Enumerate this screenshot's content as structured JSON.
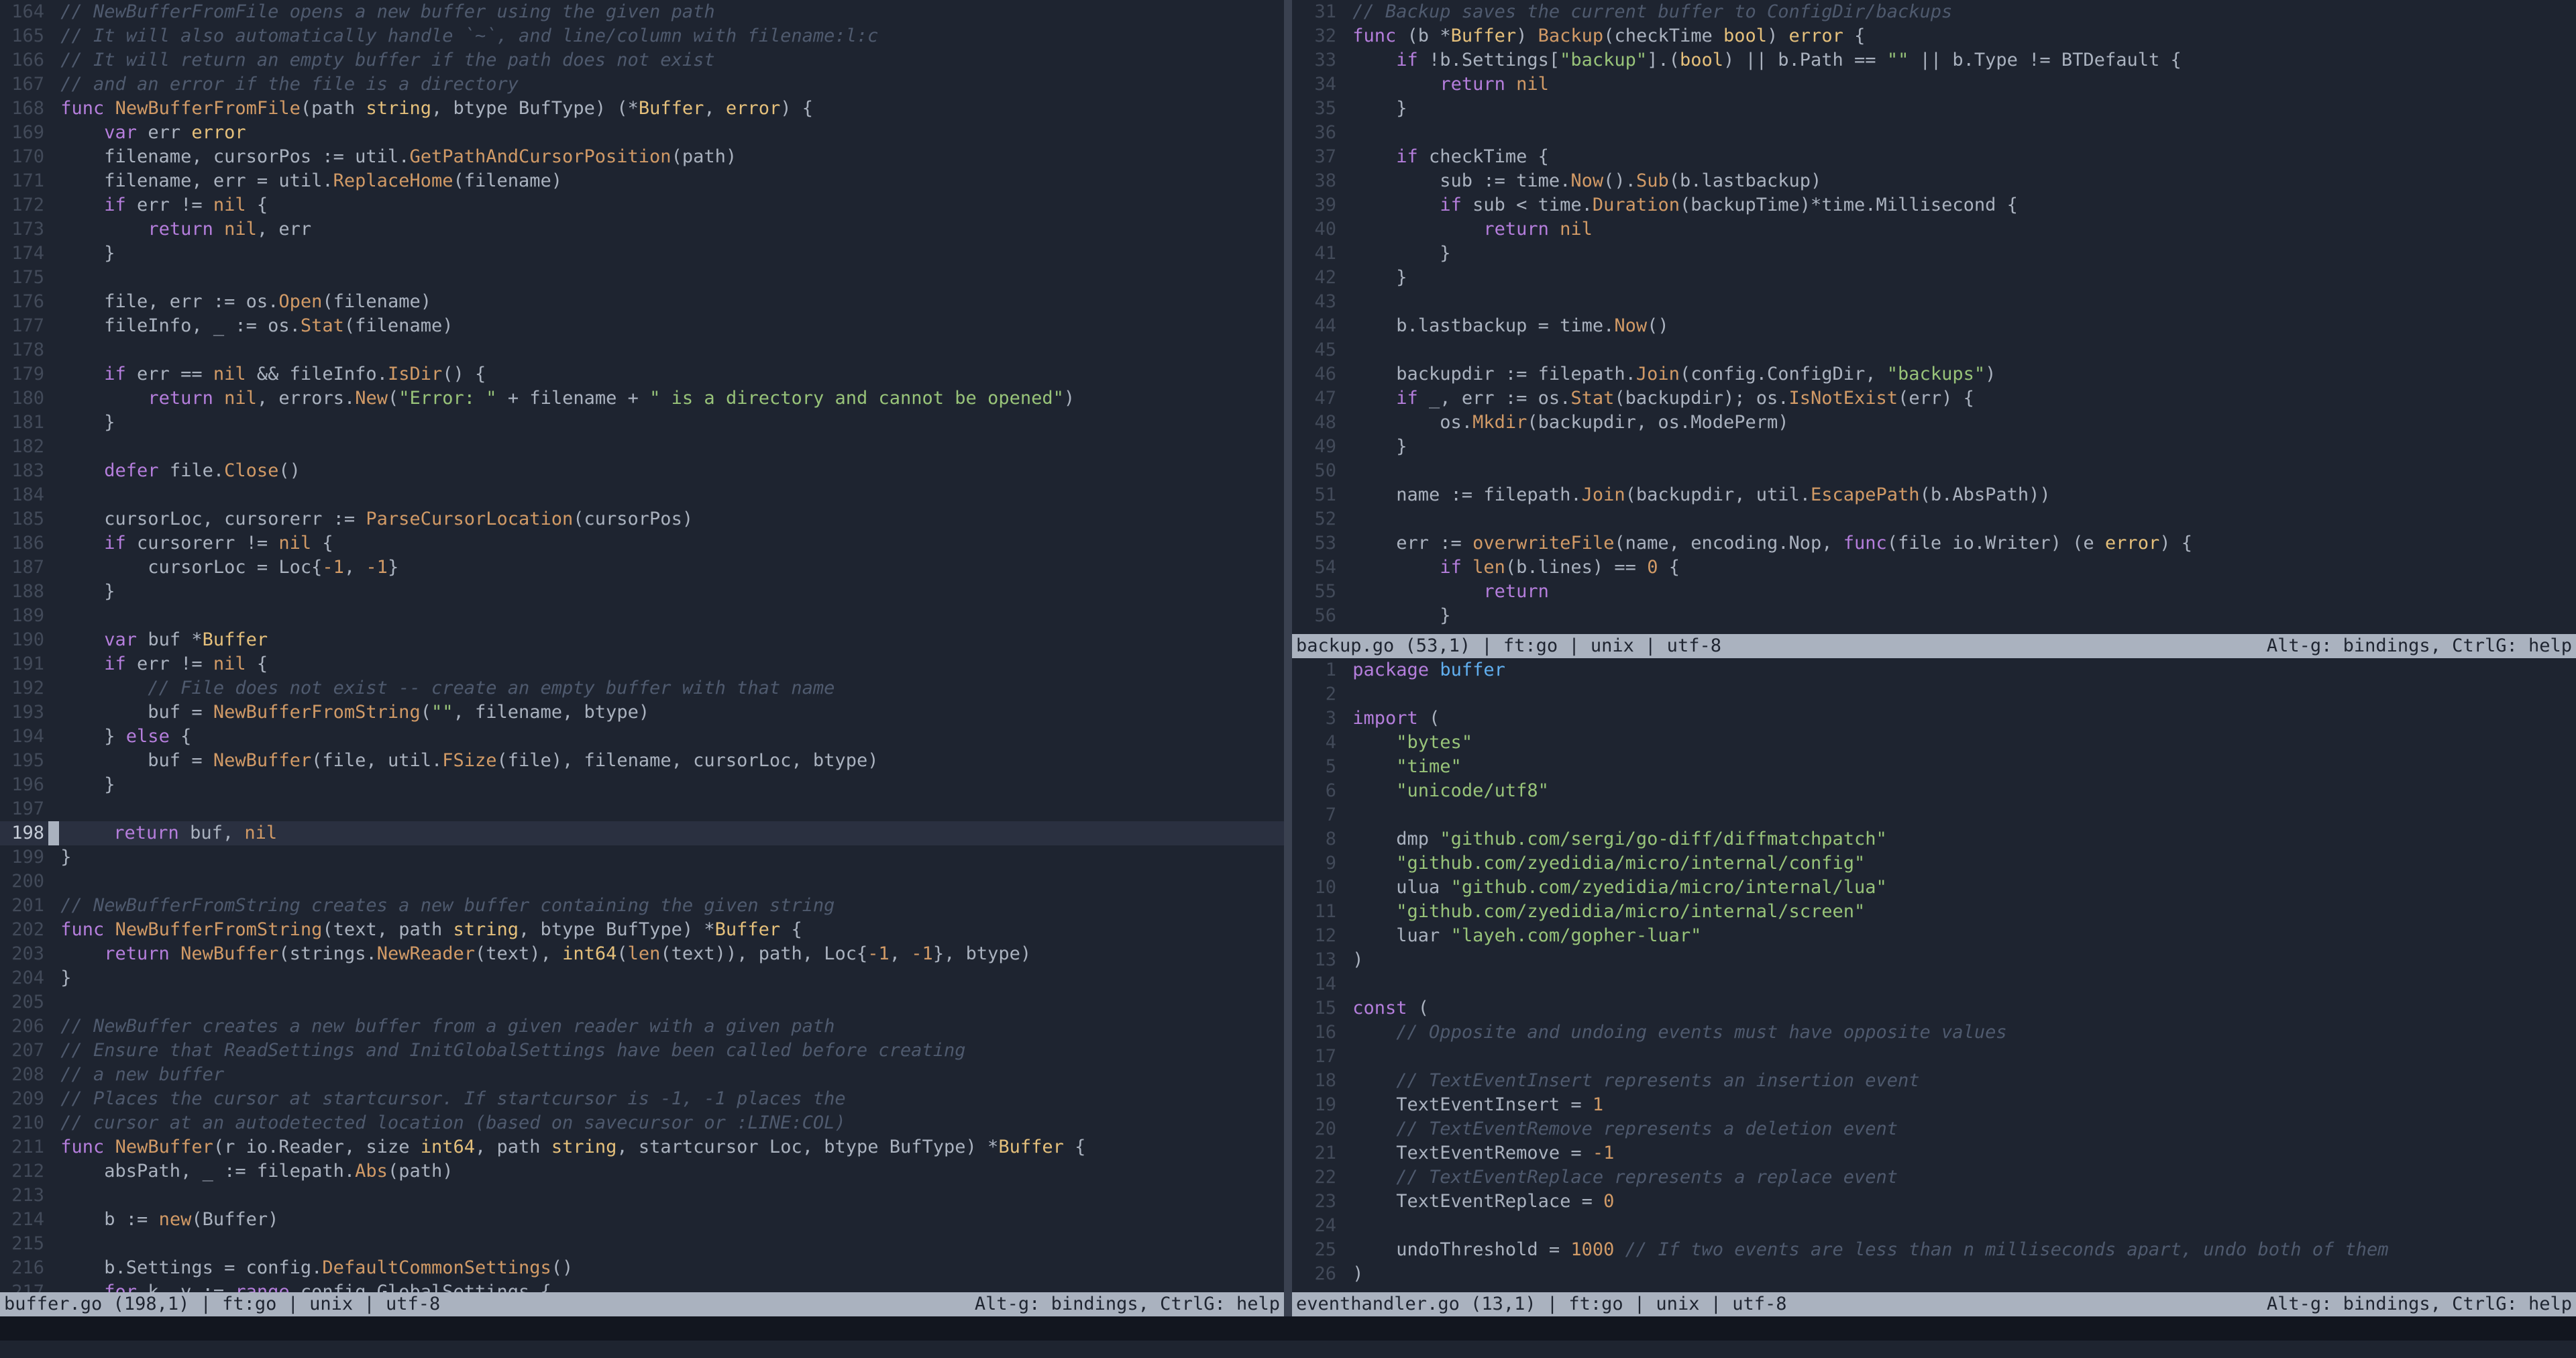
{
  "left": {
    "status_left": "buffer.go (198,1) | ft:go | unix | utf-8",
    "status_right": "Alt-g: bindings, CtrlG: help",
    "start": 164,
    "cursor_line": 198,
    "lines": [
      {
        "t": "cmt",
        "s": "// NewBufferFromFile opens a new buffer using the given path"
      },
      {
        "t": "cmt",
        "s": "// It will also automatically handle `~`, and line/column with filename:l:c"
      },
      {
        "t": "cmt",
        "s": "// It will return an empty buffer if the path does not exist"
      },
      {
        "t": "cmt",
        "s": "// and an error if the file is a directory"
      },
      {
        "t": "code",
        "h": "<span class='kw'>func</span> <span class='fn'>NewBufferFromFile</span>(path <span class='typ'>string</span>, btype BufType) (*<span class='typ'>Buffer</span>, <span class='typ'>error</span>) {"
      },
      {
        "t": "code",
        "h": "    <span class='kw'>var</span> err <span class='typ'>error</span>"
      },
      {
        "t": "code",
        "h": "    filename, cursorPos := util.<span class='fn'>GetPathAndCursorPosition</span>(path)"
      },
      {
        "t": "code",
        "h": "    filename, err = util.<span class='fn'>ReplaceHome</span>(filename)"
      },
      {
        "t": "code",
        "h": "    <span class='kw'>if</span> err != <span class='bool'>nil</span> {"
      },
      {
        "t": "code",
        "h": "        <span class='kw'>return</span> <span class='bool'>nil</span>, err"
      },
      {
        "t": "code",
        "h": "    }"
      },
      {
        "t": "code",
        "h": ""
      },
      {
        "t": "code",
        "h": "    file, err := os.<span class='fn'>Open</span>(filename)"
      },
      {
        "t": "code",
        "h": "    fileInfo, _ := os.<span class='fn'>Stat</span>(filename)"
      },
      {
        "t": "code",
        "h": ""
      },
      {
        "t": "code",
        "h": "    <span class='kw'>if</span> err == <span class='bool'>nil</span> &amp;&amp; fileInfo.<span class='fn'>IsDir</span>() {"
      },
      {
        "t": "code",
        "h": "        <span class='kw'>return</span> <span class='bool'>nil</span>, errors.<span class='fn'>New</span>(<span class='str'>\"Error: \"</span> + filename + <span class='str'>\" is a directory and cannot be opened\"</span>)"
      },
      {
        "t": "code",
        "h": "    }"
      },
      {
        "t": "code",
        "h": ""
      },
      {
        "t": "code",
        "h": "    <span class='kw'>defer</span> file.<span class='fn'>Close</span>()"
      },
      {
        "t": "code",
        "h": ""
      },
      {
        "t": "code",
        "h": "    cursorLoc, cursorerr := <span class='fn'>ParseCursorLocation</span>(cursorPos)"
      },
      {
        "t": "code",
        "h": "    <span class='kw'>if</span> cursorerr != <span class='bool'>nil</span> {"
      },
      {
        "t": "code",
        "h": "        cursorLoc = Loc{<span class='num'>-1</span>, <span class='num'>-1</span>}"
      },
      {
        "t": "code",
        "h": "    }"
      },
      {
        "t": "code",
        "h": ""
      },
      {
        "t": "code",
        "h": "    <span class='kw'>var</span> buf *<span class='typ'>Buffer</span>"
      },
      {
        "t": "code",
        "h": "    <span class='kw'>if</span> err != <span class='bool'>nil</span> {"
      },
      {
        "t": "cmt",
        "s": "        // File does not exist -- create an empty buffer with that name"
      },
      {
        "t": "code",
        "h": "        buf = <span class='fn'>NewBufferFromString</span>(<span class='str'>\"\"</span>, filename, btype)"
      },
      {
        "t": "code",
        "h": "    } <span class='kw'>else</span> {"
      },
      {
        "t": "code",
        "h": "        buf = <span class='fn'>NewBuffer</span>(file, util.<span class='fn'>FSize</span>(file), filename, cursorLoc, btype)"
      },
      {
        "t": "code",
        "h": "    }"
      },
      {
        "t": "code",
        "h": ""
      },
      {
        "t": "code",
        "h": "    <span class='kw'>return</span> buf, <span class='bool'>nil</span>"
      },
      {
        "t": "code",
        "h": "}"
      },
      {
        "t": "code",
        "h": ""
      },
      {
        "t": "cmt",
        "s": "// NewBufferFromString creates a new buffer containing the given string"
      },
      {
        "t": "code",
        "h": "<span class='kw'>func</span> <span class='fn'>NewBufferFromString</span>(text, path <span class='typ'>string</span>, btype BufType) *<span class='typ'>Buffer</span> {"
      },
      {
        "t": "code",
        "h": "    <span class='kw'>return</span> <span class='fn'>NewBuffer</span>(strings.<span class='fn'>NewReader</span>(text), <span class='typ'>int64</span>(<span class='fn'>len</span>(text)), path, Loc{<span class='num'>-1</span>, <span class='num'>-1</span>}, btype)"
      },
      {
        "t": "code",
        "h": "}"
      },
      {
        "t": "code",
        "h": ""
      },
      {
        "t": "cmt",
        "s": "// NewBuffer creates a new buffer from a given reader with a given path"
      },
      {
        "t": "cmt",
        "s": "// Ensure that ReadSettings and InitGlobalSettings have been called before creating"
      },
      {
        "t": "cmt",
        "s": "// a new buffer"
      },
      {
        "t": "cmt",
        "s": "// Places the cursor at startcursor. If startcursor is -1, -1 places the"
      },
      {
        "t": "cmt",
        "s": "// cursor at an autodetected location (based on savecursor or :LINE:COL)"
      },
      {
        "t": "code",
        "h": "<span class='kw'>func</span> <span class='fn'>NewBuffer</span>(r io.Reader, size <span class='typ'>int64</span>, path <span class='typ'>string</span>, startcursor Loc, btype BufType) *<span class='typ'>Buffer</span> {"
      },
      {
        "t": "code",
        "h": "    absPath, _ := filepath.<span class='fn'>Abs</span>(path)"
      },
      {
        "t": "code",
        "h": ""
      },
      {
        "t": "code",
        "h": "    b := <span class='fn'>new</span>(Buffer)"
      },
      {
        "t": "code",
        "h": ""
      },
      {
        "t": "code",
        "h": "    b.Settings = config.<span class='fn'>DefaultCommonSettings</span>()"
      },
      {
        "t": "code",
        "h": "    <span class='kw'>for</span> k, v := <span class='kw'>range</span> config.GlobalSettings {"
      }
    ]
  },
  "right_top": {
    "status_left": "backup.go (53,1) | ft:go | unix | utf-8",
    "status_right": "Alt-g: bindings, CtrlG: help",
    "start": 31,
    "lines": [
      {
        "t": "cmt",
        "s": "// Backup saves the current buffer to ConfigDir/backups"
      },
      {
        "t": "code",
        "h": "<span class='kw'>func</span> (b *<span class='typ'>Buffer</span>) <span class='fn'>Backup</span>(checkTime <span class='typ'>bool</span>) <span class='typ'>error</span> {"
      },
      {
        "t": "code",
        "h": "    <span class='kw'>if</span> !b.Settings[<span class='str'>\"backup\"</span>].(<span class='typ'>bool</span>) || b.Path == <span class='str'>\"\"</span> || b.Type != BTDefault {"
      },
      {
        "t": "code",
        "h": "        <span class='kw'>return</span> <span class='bool'>nil</span>"
      },
      {
        "t": "code",
        "h": "    }"
      },
      {
        "t": "code",
        "h": ""
      },
      {
        "t": "code",
        "h": "    <span class='kw'>if</span> checkTime {"
      },
      {
        "t": "code",
        "h": "        sub := time.<span class='fn'>Now</span>().<span class='fn'>Sub</span>(b.lastbackup)"
      },
      {
        "t": "code",
        "h": "        <span class='kw'>if</span> sub &lt; time.<span class='fn'>Duration</span>(backupTime)*time.Millisecond {"
      },
      {
        "t": "code",
        "h": "            <span class='kw'>return</span> <span class='bool'>nil</span>"
      },
      {
        "t": "code",
        "h": "        }"
      },
      {
        "t": "code",
        "h": "    }"
      },
      {
        "t": "code",
        "h": ""
      },
      {
        "t": "code",
        "h": "    b.lastbackup = time.<span class='fn'>Now</span>()"
      },
      {
        "t": "code",
        "h": ""
      },
      {
        "t": "code",
        "h": "    backupdir := filepath.<span class='fn'>Join</span>(config.ConfigDir, <span class='str'>\"backups\"</span>)"
      },
      {
        "t": "code",
        "h": "    <span class='kw'>if</span> _, err := os.<span class='fn'>Stat</span>(backupdir); os.<span class='fn'>IsNotExist</span>(err) {"
      },
      {
        "t": "code",
        "h": "        os.<span class='fn'>Mkdir</span>(backupdir, os.ModePerm)"
      },
      {
        "t": "code",
        "h": "    }"
      },
      {
        "t": "code",
        "h": ""
      },
      {
        "t": "code",
        "h": "    name := filepath.<span class='fn'>Join</span>(backupdir, util.<span class='fn'>EscapePath</span>(b.AbsPath))"
      },
      {
        "t": "code",
        "h": ""
      },
      {
        "t": "code",
        "h": "    err := <span class='fn'>overwriteFile</span>(name, encoding.Nop, <span class='kw'>func</span>(file io.Writer) (e <span class='typ'>error</span>) {"
      },
      {
        "t": "code",
        "h": "        <span class='kw'>if</span> <span class='fn'>len</span>(b.lines) == <span class='num'>0</span> {"
      },
      {
        "t": "code",
        "h": "            <span class='kw'>return</span>"
      },
      {
        "t": "code",
        "h": "        }"
      }
    ]
  },
  "right_bot": {
    "status_left": "eventhandler.go (13,1) | ft:go | unix | utf-8",
    "status_right": "Alt-g: bindings, CtrlG: help",
    "start": 1,
    "lines": [
      {
        "t": "code",
        "h": "<span class='kw'>package</span> <span class='pkg'>buffer</span>"
      },
      {
        "t": "code",
        "h": ""
      },
      {
        "t": "code",
        "h": "<span class='kw'>import</span> ("
      },
      {
        "t": "code",
        "h": "    <span class='str'>\"bytes\"</span>"
      },
      {
        "t": "code",
        "h": "    <span class='str'>\"time\"</span>"
      },
      {
        "t": "code",
        "h": "    <span class='str'>\"unicode/utf8\"</span>"
      },
      {
        "t": "code",
        "h": ""
      },
      {
        "t": "code",
        "h": "    dmp <span class='str'>\"github.com/sergi/go-diff/diffmatchpatch\"</span>"
      },
      {
        "t": "code",
        "h": "    <span class='str'>\"github.com/zyedidia/micro/internal/config\"</span>"
      },
      {
        "t": "code",
        "h": "    ulua <span class='str'>\"github.com/zyedidia/micro/internal/lua\"</span>"
      },
      {
        "t": "code",
        "h": "    <span class='str'>\"github.com/zyedidia/micro/internal/screen\"</span>"
      },
      {
        "t": "code",
        "h": "    luar <span class='str'>\"layeh.com/gopher-luar\"</span>"
      },
      {
        "t": "code",
        "h": ")"
      },
      {
        "t": "code",
        "h": ""
      },
      {
        "t": "code",
        "h": "<span class='kw'>const</span> ("
      },
      {
        "t": "cmt",
        "s": "    // Opposite and undoing events must have opposite values"
      },
      {
        "t": "code",
        "h": ""
      },
      {
        "t": "cmt",
        "s": "    // TextEventInsert represents an insertion event"
      },
      {
        "t": "code",
        "h": "    TextEventInsert = <span class='num'>1</span>"
      },
      {
        "t": "cmt",
        "s": "    // TextEventRemove represents a deletion event"
      },
      {
        "t": "code",
        "h": "    TextEventRemove = <span class='num'>-1</span>"
      },
      {
        "t": "cmt",
        "s": "    // TextEventReplace represents a replace event"
      },
      {
        "t": "code",
        "h": "    TextEventReplace = <span class='num'>0</span>"
      },
      {
        "t": "code",
        "h": ""
      },
      {
        "t": "code",
        "h": "    undoThreshold = <span class='num'>1000</span> <span class='cmt'>// If two events are less than n milliseconds apart, undo both of them</span>"
      },
      {
        "t": "code",
        "h": ")"
      }
    ]
  }
}
